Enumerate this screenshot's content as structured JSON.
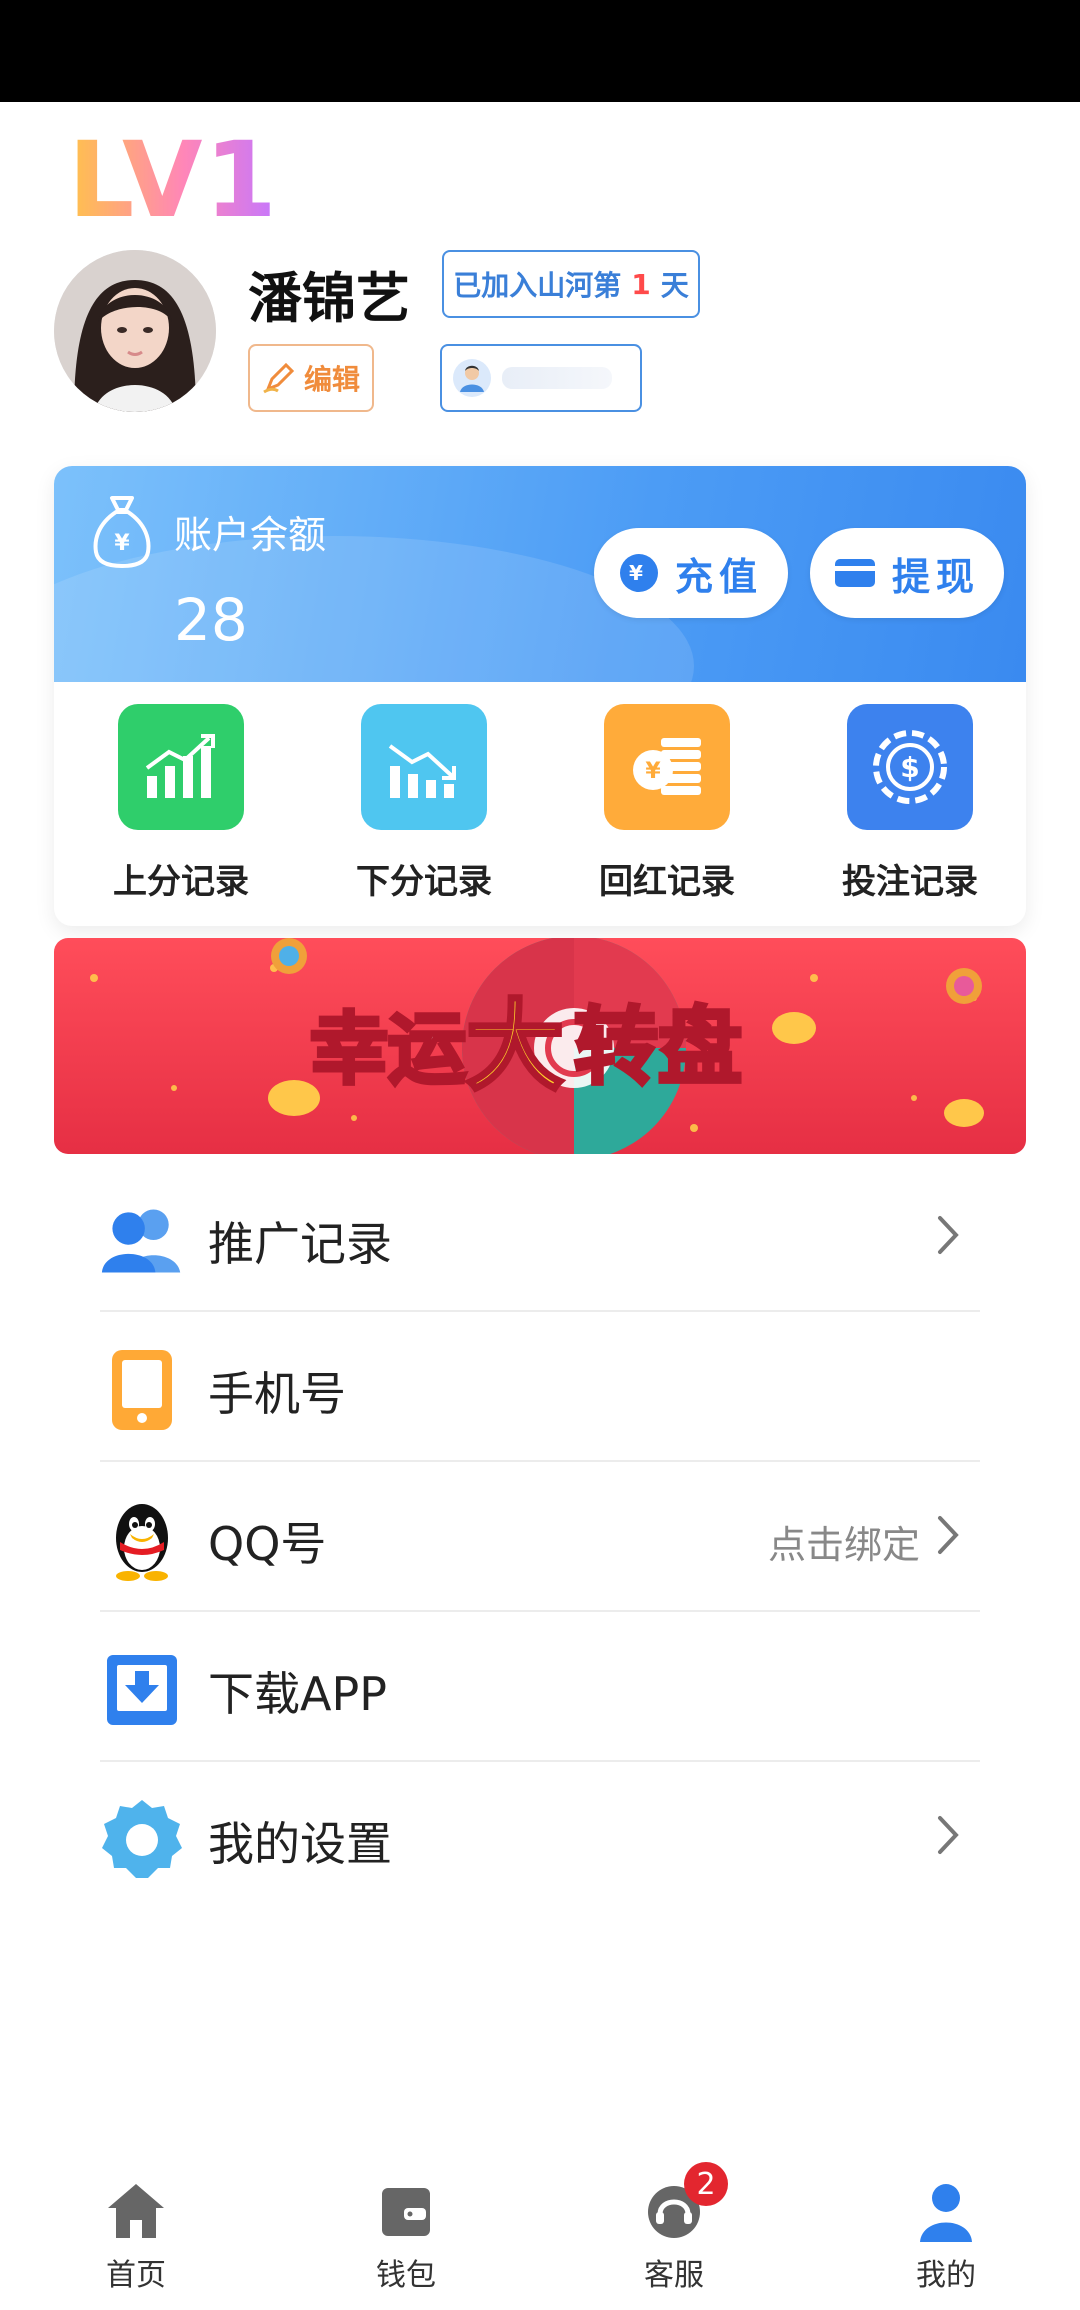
{
  "profile": {
    "level": "LV1",
    "username": "潘锦艺",
    "join_prefix": "已加入山河第",
    "join_days": "1",
    "join_suffix": "天",
    "edit_label": "编辑"
  },
  "balance": {
    "label": "账户余额",
    "value": "28",
    "recharge_label": "充值",
    "withdraw_label": "提现"
  },
  "records": [
    {
      "label": "上分记录",
      "color": "#2fce6b"
    },
    {
      "label": "下分记录",
      "color": "#4fc6f0"
    },
    {
      "label": "回红记录",
      "color": "#ffab3a"
    },
    {
      "label": "投注记录",
      "color": "#3d82ee"
    }
  ],
  "banner": {
    "text_1": "幸运",
    "text_2": "大",
    "text_3": "转盘"
  },
  "menu": [
    {
      "label": "推广记录",
      "icon": "users-icon",
      "hint": "",
      "chevron": true
    },
    {
      "label": "手机号",
      "icon": "phone-icon",
      "hint": "",
      "chevron": false
    },
    {
      "label": "QQ号",
      "icon": "qq-icon",
      "hint": "点击绑定",
      "chevron": true
    },
    {
      "label": "下载APP",
      "icon": "download-icon",
      "hint": "",
      "chevron": false
    },
    {
      "label": "我的设置",
      "icon": "gear-icon",
      "hint": "",
      "chevron": true
    }
  ],
  "nav": {
    "home": "首页",
    "wallet": "钱包",
    "service": "客服",
    "service_badge": "2",
    "mine": "我的"
  },
  "colors": {
    "primary": "#3a8af0",
    "status_bar": "#000000",
    "badge": "#e3262f"
  }
}
